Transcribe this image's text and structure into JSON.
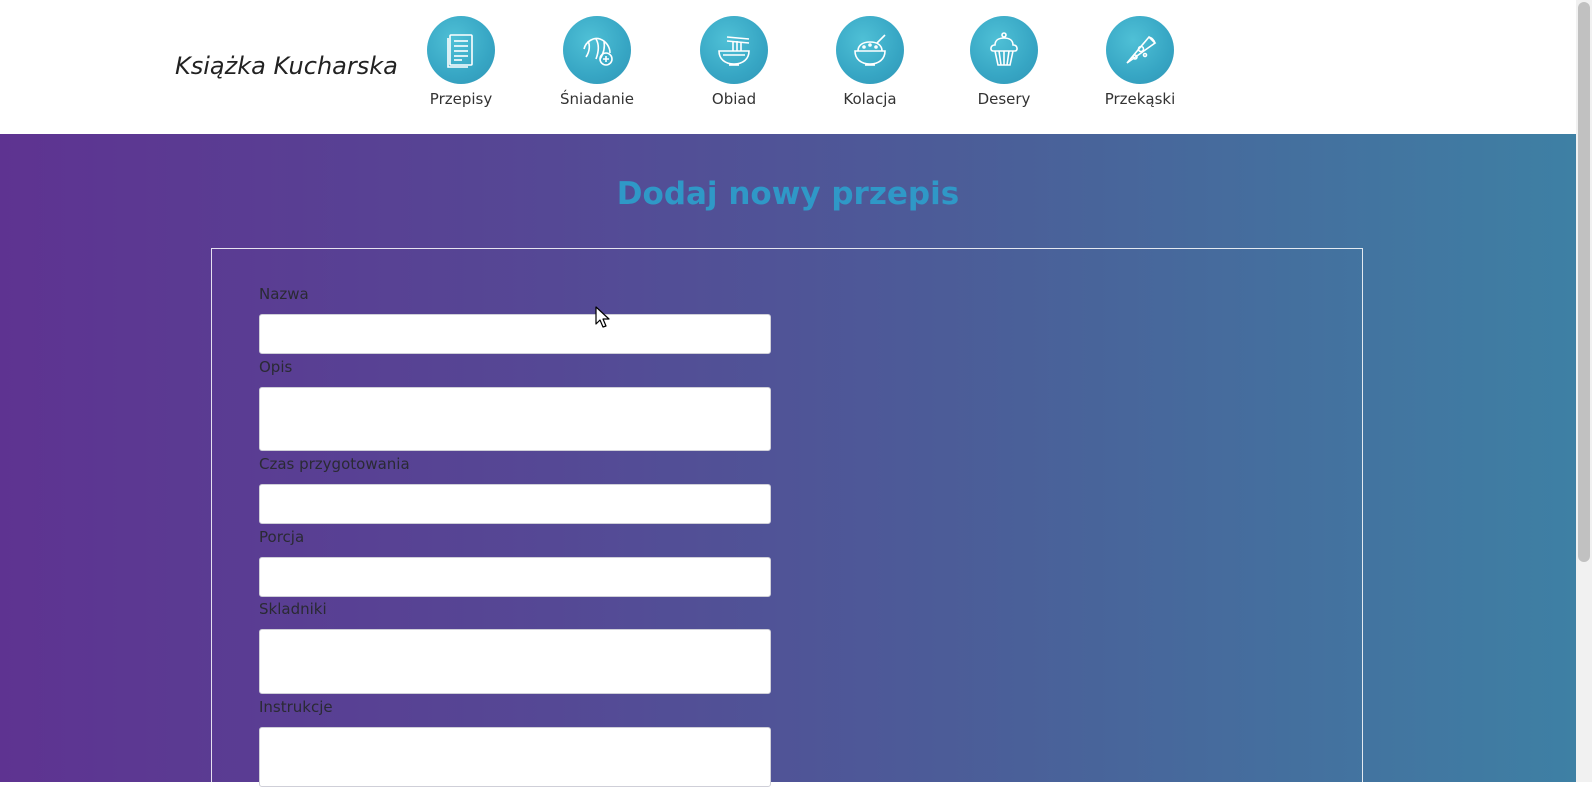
{
  "header": {
    "brand": "Książka Kucharska",
    "nav": [
      {
        "label": "Przepisy",
        "icon": "recipe-document-icon"
      },
      {
        "label": "Śniadanie",
        "icon": "croissant-icon"
      },
      {
        "label": "Obiad",
        "icon": "noodle-bowl-icon"
      },
      {
        "label": "Kolacja",
        "icon": "rice-bowl-icon"
      },
      {
        "label": "Desery",
        "icon": "cupcake-icon"
      },
      {
        "label": "Przekąski",
        "icon": "pizza-slice-icon"
      }
    ]
  },
  "main": {
    "title": "Dodaj nowy przepis",
    "form": {
      "name_label": "Nazwa",
      "name_value": "",
      "description_label": "Opis",
      "description_value": "",
      "prep_time_label": "Czas przygotowania",
      "prep_time_value": "",
      "portion_label": "Porcja",
      "portion_value": "",
      "ingredients_label": "Skladniki",
      "ingredients_value": "",
      "instructions_label": "Instrukcje",
      "instructions_value": ""
    }
  },
  "colors": {
    "title": "#2f98c7",
    "gradient_start": "#5e3391",
    "gradient_end": "#3e80a4",
    "icon_circle": "#37a6c4"
  }
}
